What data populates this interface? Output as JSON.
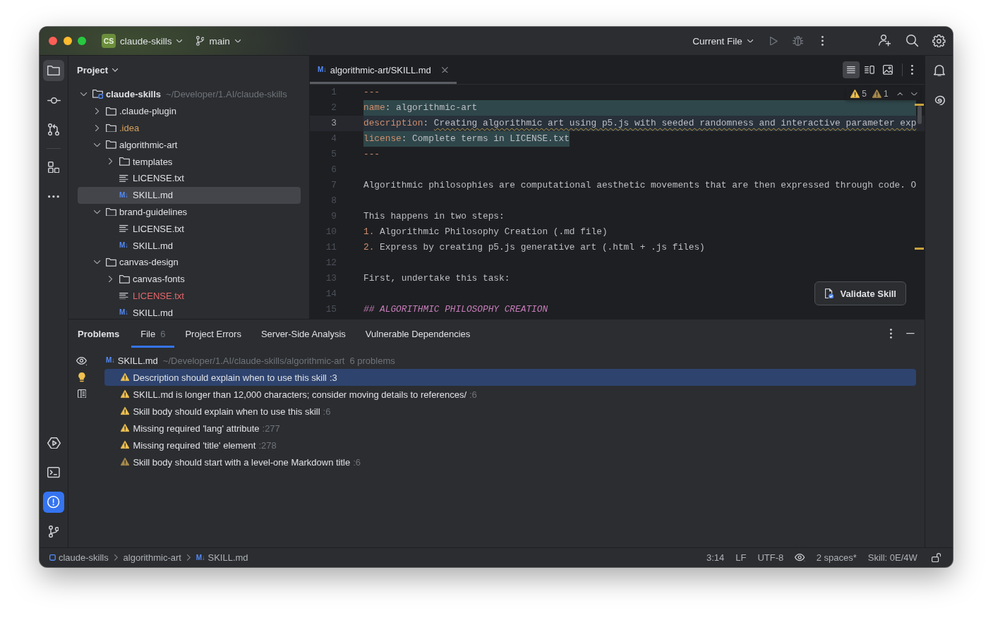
{
  "title_bar": {
    "project": {
      "badge": "CS",
      "name": "claude-skills"
    },
    "branch": "main",
    "run_configuration": "Current File"
  },
  "left_toolbar": {
    "top": [
      {
        "selected": true
      },
      {
        "selected": false
      },
      {
        "selected": false
      },
      {
        "selected": false
      },
      {
        "selected": false
      }
    ],
    "bottom": [
      {
        "selected": false
      },
      {
        "selected": false
      },
      {
        "selected": true
      },
      {
        "selected": false
      }
    ]
  },
  "project_panel": {
    "title": "Project",
    "tree": [
      {
        "kind": "module",
        "name": "claude-skills",
        "path": "~/Developer/1.AI/claude-skills",
        "expanded": true,
        "selected": false,
        "children": [
          {
            "kind": "folder",
            "name": ".claude-plugin",
            "expanded": false,
            "selected": false
          },
          {
            "kind": "folder",
            "name": ".idea",
            "expanded": false,
            "selected": false,
            "color": "#d5a05f"
          },
          {
            "kind": "folder",
            "name": "algorithmic-art",
            "expanded": true,
            "selected": false,
            "children": [
              {
                "kind": "folder",
                "name": "templates",
                "expanded": false,
                "selected": false
              },
              {
                "kind": "text",
                "name": "LICENSE.txt",
                "selected": false
              },
              {
                "kind": "markdown",
                "glyph": "M↓",
                "name": "SKILL.md",
                "selected": true
              }
            ]
          },
          {
            "kind": "folder",
            "name": "brand-guidelines",
            "expanded": true,
            "selected": false,
            "children": [
              {
                "kind": "text",
                "name": "LICENSE.txt",
                "selected": false
              },
              {
                "kind": "markdown",
                "glyph": "M↓",
                "name": "SKILL.md",
                "selected": false
              }
            ]
          },
          {
            "kind": "folder",
            "name": "canvas-design",
            "expanded": true,
            "selected": false,
            "children": [
              {
                "kind": "folder",
                "name": "canvas-fonts",
                "expanded": false,
                "selected": false
              },
              {
                "kind": "text",
                "name": "LICENSE.txt",
                "selected": false,
                "color": "#e5676b"
              },
              {
                "kind": "markdown",
                "glyph": "M↓",
                "name": "SKILL.md",
                "selected": false
              }
            ]
          }
        ]
      }
    ]
  },
  "editor": {
    "tab": {
      "glyph": "M↓",
      "title": "algorithmic-art/SKILL.md",
      "selected": true
    },
    "view_modes": [
      {
        "selected": true
      },
      {
        "selected": false
      },
      {
        "selected": false
      }
    ],
    "inspections": [
      {
        "kind": "warning",
        "count": "5"
      },
      {
        "kind": "weak_warning",
        "count": "1"
      }
    ],
    "lines": [
      {
        "number": "1",
        "current": false,
        "highlighted": false,
        "segments": [
          {
            "kind": "syntax",
            "text": "---"
          }
        ]
      },
      {
        "number": "2",
        "current": false,
        "highlighted": true,
        "segments": [
          {
            "kind": "syntax",
            "text": "name"
          },
          {
            "kind": "plain",
            "text": ": algorithmic-art"
          }
        ]
      },
      {
        "number": "3",
        "current": true,
        "highlighted": true,
        "segments": [
          {
            "kind": "syntax",
            "text": "description"
          },
          {
            "kind": "plain",
            "text": ": "
          },
          {
            "kind": "warned",
            "text": "Creating algorithmic art using p5.js with seeded randomness and interactive parameter exp"
          }
        ]
      },
      {
        "number": "4",
        "current": false,
        "highlighted": true,
        "segments": [
          {
            "kind": "syntax",
            "text": "license"
          },
          {
            "kind": "plain",
            "text": ": Complete terms in LICENSE.txt"
          }
        ]
      },
      {
        "number": "5",
        "current": false,
        "highlighted": false,
        "segments": [
          {
            "kind": "syntax",
            "text": "---"
          }
        ]
      },
      {
        "number": "6",
        "current": false,
        "highlighted": false
      },
      {
        "number": "7",
        "current": false,
        "highlighted": false,
        "segments": [
          {
            "kind": "plain",
            "text": "Algorithmic philosophies are computational aesthetic movements that are then expressed through code. O"
          }
        ]
      },
      {
        "number": "8",
        "current": false,
        "highlighted": false
      },
      {
        "number": "9",
        "current": false,
        "highlighted": false,
        "segments": [
          {
            "kind": "plain",
            "text": "This happens in two steps:"
          }
        ]
      },
      {
        "number": "10",
        "current": false,
        "highlighted": false,
        "segments": [
          {
            "kind": "syntax",
            "text": "1."
          },
          {
            "kind": "plain",
            "text": " Algorithmic Philosophy Creation (.md file)"
          }
        ]
      },
      {
        "number": "11",
        "current": false,
        "highlighted": false,
        "segments": [
          {
            "kind": "syntax",
            "text": "2."
          },
          {
            "kind": "plain",
            "text": " Express by creating p5.js generative art (.html + .js files)"
          }
        ]
      },
      {
        "number": "12",
        "current": false,
        "highlighted": false
      },
      {
        "number": "13",
        "current": false,
        "highlighted": false,
        "segments": [
          {
            "kind": "plain",
            "text": "First, undertake this task:"
          }
        ]
      },
      {
        "number": "14",
        "current": false,
        "highlighted": false
      },
      {
        "number": "15",
        "current": false,
        "highlighted": false,
        "segments": [
          {
            "kind": "heading",
            "text": "## ALGORITHMIC PHILOSOPHY CREATION"
          }
        ]
      }
    ],
    "action_button": "Validate Skill"
  },
  "problems_panel": {
    "title": "Problems",
    "tabs": [
      {
        "label": "File",
        "count": "6",
        "selected": true
      },
      {
        "label": "Project Errors",
        "selected": false
      },
      {
        "label": "Server-Side Analysis",
        "selected": false
      },
      {
        "label": "Vulnerable Dependencies",
        "selected": false
      }
    ],
    "file": {
      "glyph": "M↓",
      "name": "SKILL.md",
      "path": "~/Developer/1.AI/claude-skills/algorithmic-art",
      "summary": "6 problems"
    },
    "items": [
      {
        "kind": "warning",
        "message": "Description should explain when to use this skill",
        "location": ":3",
        "selected": true
      },
      {
        "kind": "warning",
        "message": "SKILL.md is longer than 12,000 characters; consider moving details to references/",
        "location": ":6",
        "selected": false
      },
      {
        "kind": "warning",
        "message": "Skill body should explain when to use this skill",
        "location": ":6",
        "selected": false
      },
      {
        "kind": "warning",
        "message": "Missing required 'lang' attribute",
        "location": ":277",
        "selected": false
      },
      {
        "kind": "warning",
        "message": "Missing required 'title' element",
        "location": ":278",
        "selected": false
      },
      {
        "kind": "weak_warning",
        "message": "Skill body should start with a level-one Markdown title",
        "location": ":6",
        "selected": false
      }
    ]
  },
  "status_bar": {
    "breadcrumbs": [
      {
        "kind": "module",
        "label": "claude-skills"
      },
      {
        "kind": "folder",
        "label": "algorithmic-art"
      },
      {
        "kind": "markdown",
        "glyph": "M↓",
        "label": "SKILL.md"
      }
    ],
    "caret_position": "3:14",
    "line_separator": "LF",
    "encoding": "UTF-8",
    "indent": "2 spaces*",
    "skill_status": "Skill: 0E/4W"
  }
}
